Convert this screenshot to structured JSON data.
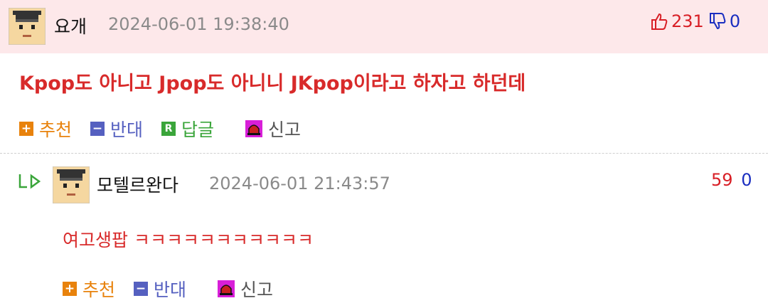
{
  "comments": [
    {
      "nickname": "요개",
      "date": "2024-06-01 19:38:40",
      "up": "231",
      "down": "0",
      "text": "Kpop도 아니고 Jpop도 아니니 JKpop이라고 하자고 하던데",
      "actions": {
        "recommend": "추천",
        "oppose": "반대",
        "reply": "답글",
        "report": "신고"
      }
    },
    {
      "nickname": "모텔르완다",
      "date": "2024-06-01 21:43:57",
      "up": "59",
      "down": "0",
      "text": "여고생팝 ㅋㅋㅋㅋㅋㅋㅋㅋㅋㅋㅋ",
      "actions": {
        "recommend": "추천",
        "oppose": "반대",
        "report": "신고"
      }
    }
  ],
  "colors": {
    "highlight_bg": "#fde8ea",
    "recommend": "#e8820c",
    "oppose": "#5560c0",
    "reply": "#3aa53a",
    "report": "#d81fd8"
  }
}
